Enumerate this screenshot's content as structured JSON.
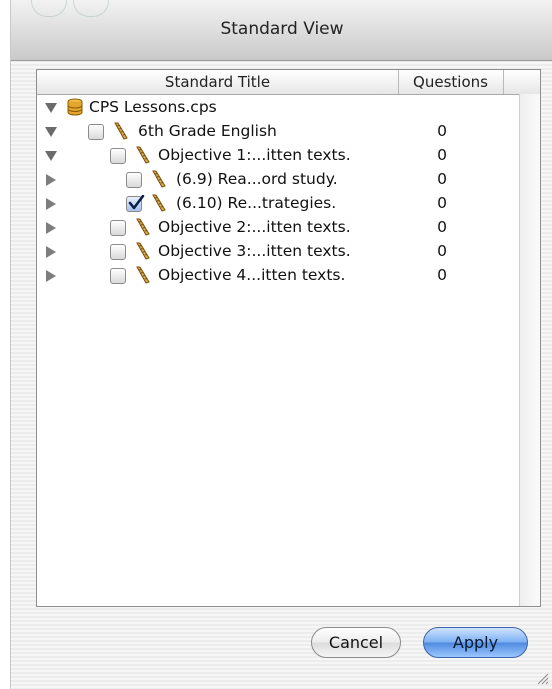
{
  "window": {
    "title": "Standard View"
  },
  "columns": {
    "title": "Standard Title",
    "questions": "Questions"
  },
  "rows": [
    {
      "label": "CPS Lessons.cps",
      "expanded": true,
      "checkbox": false,
      "checked": false,
      "questions": "",
      "icon": "database-icon"
    },
    {
      "label": "6th Grade English",
      "expanded": true,
      "checkbox": true,
      "checked": false,
      "questions": "0",
      "icon": "ruler-icon"
    },
    {
      "label": "Objective 1:...itten texts.",
      "expanded": true,
      "checkbox": true,
      "checked": false,
      "questions": "0",
      "icon": "ruler-icon"
    },
    {
      "label": "(6.9)  Rea...ord study.",
      "expanded": false,
      "checkbox": true,
      "checked": false,
      "questions": "0",
      "icon": "ruler-icon"
    },
    {
      "label": "(6.10)  Re...trategies.",
      "expanded": false,
      "checkbox": true,
      "checked": true,
      "questions": "0",
      "icon": "ruler-icon"
    },
    {
      "label": "Objective 2:...itten texts.",
      "expanded": false,
      "checkbox": true,
      "checked": false,
      "questions": "0",
      "icon": "ruler-icon"
    },
    {
      "label": "Objective 3:...itten texts.",
      "expanded": false,
      "checkbox": true,
      "checked": false,
      "questions": "0",
      "icon": "ruler-icon"
    },
    {
      "label": "Objective 4...itten texts.",
      "expanded": false,
      "checkbox": true,
      "checked": false,
      "questions": "0",
      "icon": "ruler-icon"
    }
  ],
  "buttons": {
    "cancel": "Cancel",
    "apply": "Apply"
  },
  "colors": {
    "accent": "#4f8be0"
  }
}
